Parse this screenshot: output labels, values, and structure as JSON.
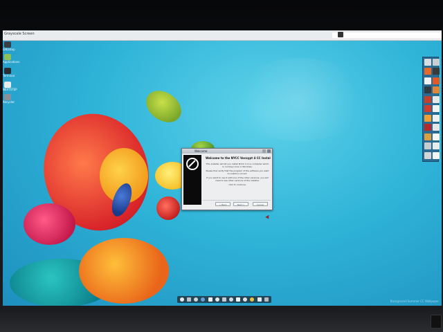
{
  "screen": {
    "title": "Grayscale Screen"
  },
  "desktop_icons": [
    {
      "icon": "home-folder-icon",
      "label": "GNUstep",
      "color": "#3a3f46"
    },
    {
      "icon": "package-icon",
      "label": "Applications",
      "color": "#8fbf5a"
    },
    {
      "icon": "terminal-icon",
      "label": "Terminal",
      "color": "#2a2e33"
    },
    {
      "icon": "disk-icon",
      "label": "NEXTSTEP",
      "color": "#e8eaec"
    },
    {
      "icon": "trash-icon",
      "label": "Recycler",
      "color": "#8a9097"
    }
  ],
  "palette": {
    "colors": [
      "#d8dde2",
      "#c9ced3",
      "#e56a2a",
      "#3a3a3a",
      "#f0f2f4",
      "#e05a2a",
      "#2f3a44",
      "#e0853a",
      "#c64028",
      "#e6e8ea",
      "#d23c2a",
      "#f2f3f4",
      "#f0a030",
      "#eef0f2",
      "#b82a2a",
      "#e5e7e9",
      "#d8a040",
      "#f6f7f8",
      "#c7ccd1",
      "#e9ebed",
      "#d2d6da",
      "#f3f4f5"
    ]
  },
  "dialog": {
    "title": "Welcome",
    "heading": "Welcome to the NYCC Vocoypt 4 CC Installer",
    "body": [
      "This installer will let you install NYCC 4 on a computer which is running Linux or Windows.",
      "Please first verify that the program of the software you want to install is correct.",
      "If you want to use it with one of the other versions, you will need to see other versions of the installer.",
      "click to continue."
    ],
    "buttons": {
      "back": "< Back",
      "next": "Next >",
      "cancel": "Cancel"
    }
  },
  "dock": {
    "items": [
      "viewer-icon",
      "settings-icon",
      "camera-icon",
      "globe-icon",
      "mail-icon",
      "eye-icon",
      "lock-icon",
      "music-icon",
      "font-icon",
      "clock-icon",
      "star-icon",
      "chat-icon",
      "switch-icon"
    ]
  },
  "watermark": "Background Summer CC Wallpaper"
}
